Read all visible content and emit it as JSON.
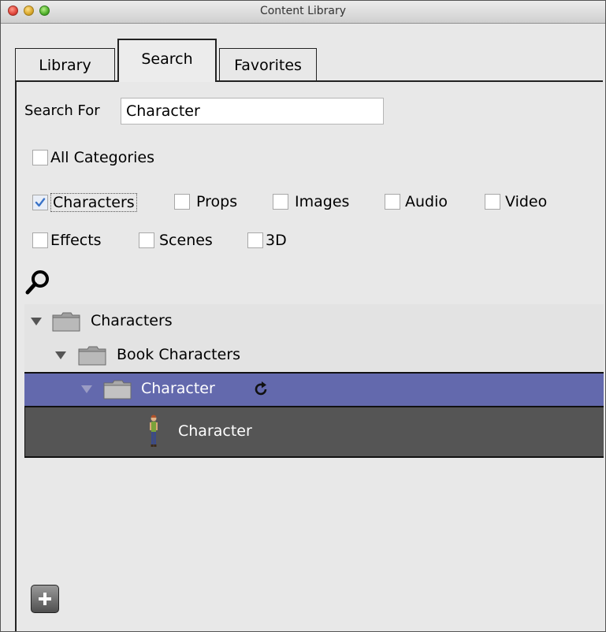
{
  "window": {
    "title": "Content Library"
  },
  "tabs": [
    {
      "label": "Library"
    },
    {
      "label": "Search"
    },
    {
      "label": "Favorites"
    }
  ],
  "search": {
    "label": "Search For",
    "value": "Character"
  },
  "checkboxes": {
    "all": {
      "label": "All Categories",
      "checked": false
    },
    "characters": {
      "label": "Characters",
      "checked": true
    },
    "props": {
      "label": "Props",
      "checked": false
    },
    "images": {
      "label": "Images",
      "checked": false
    },
    "audio": {
      "label": "Audio",
      "checked": false
    },
    "video": {
      "label": "Video",
      "checked": false
    },
    "effects": {
      "label": "Effects",
      "checked": false
    },
    "scenes": {
      "label": "Scenes",
      "checked": false
    },
    "three_d": {
      "label": "3D",
      "checked": false
    }
  },
  "tree": {
    "rows": [
      {
        "label": "Characters",
        "type": "folder",
        "expanded": true
      },
      {
        "label": "Book Characters",
        "type": "folder",
        "expanded": true
      },
      {
        "label": "Character",
        "type": "folder",
        "expanded": true,
        "selected": true
      },
      {
        "label": "Character",
        "type": "item"
      }
    ]
  },
  "colors": {
    "selected_row": "#6369ad",
    "item_row": "#555555",
    "tree_background": "#e3e3e3"
  },
  "icons": [
    "search-icon",
    "refresh-icon",
    "folder-icon",
    "character-figure-icon",
    "plus-icon"
  ]
}
